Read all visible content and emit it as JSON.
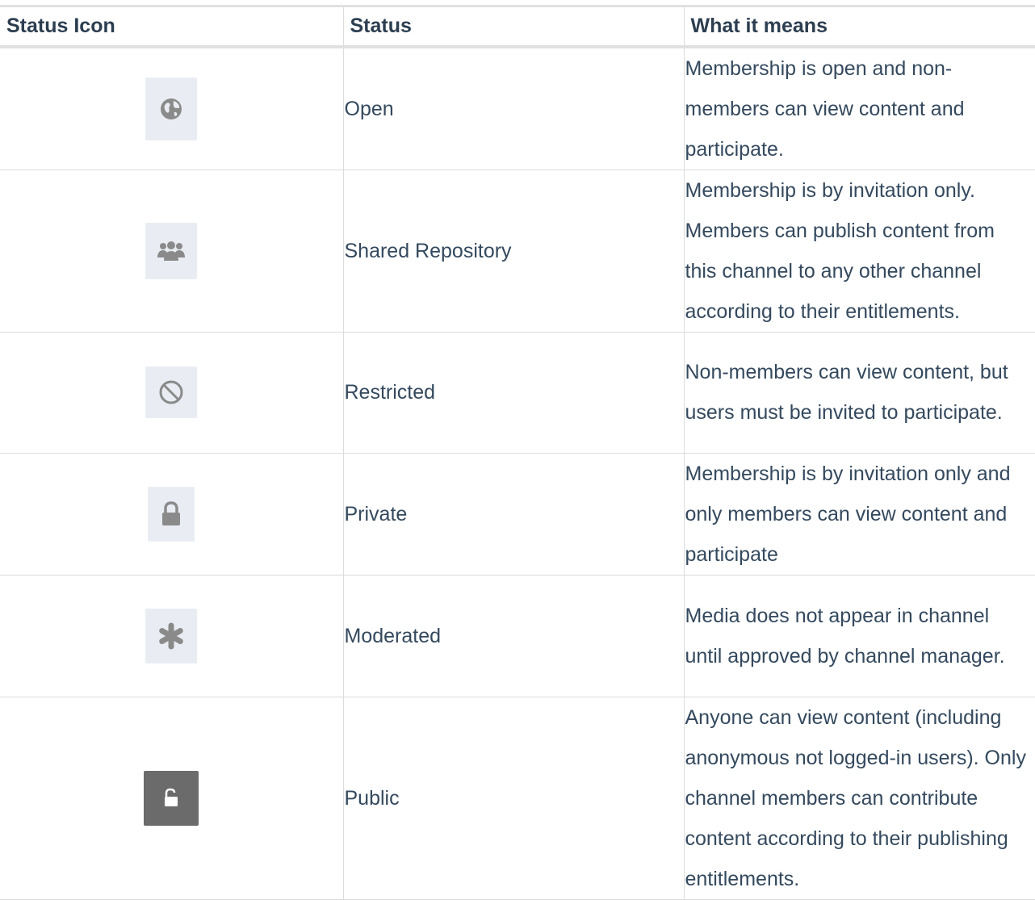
{
  "headers": {
    "icon": "Status Icon",
    "status": "Status",
    "meaning": "What it means"
  },
  "rows": [
    {
      "icon": "globe-icon",
      "status": "Open",
      "meaning": "Membership is open and non-members can view content and participate."
    },
    {
      "icon": "group-icon",
      "status": "Shared Repository",
      "meaning": "Membership is by invitation only. Members can publish content from this channel to any other channel according to their entitlements."
    },
    {
      "icon": "ban-icon",
      "status": "Restricted",
      "meaning": "Non-members can view content, but users must be invited to participate."
    },
    {
      "icon": "lock-icon",
      "status": "Private",
      "meaning": "Membership is by invitation only and only members can view content and participate"
    },
    {
      "icon": "asterisk-icon",
      "status": "Moderated",
      "meaning": "Media does not appear in channel until approved by channel manager."
    },
    {
      "icon": "unlock-icon",
      "status": "Public",
      "meaning": "Anyone can view content (including anonymous not logged-in users). Only channel members can contribute content according to their publishing entitlements."
    }
  ],
  "colors": {
    "text": "#34495e",
    "header_text": "#2c3e50",
    "icon_bg": "#e9edf3",
    "icon_fill": "#8a8a8a",
    "public_icon_bg": "#6b6b6b"
  }
}
